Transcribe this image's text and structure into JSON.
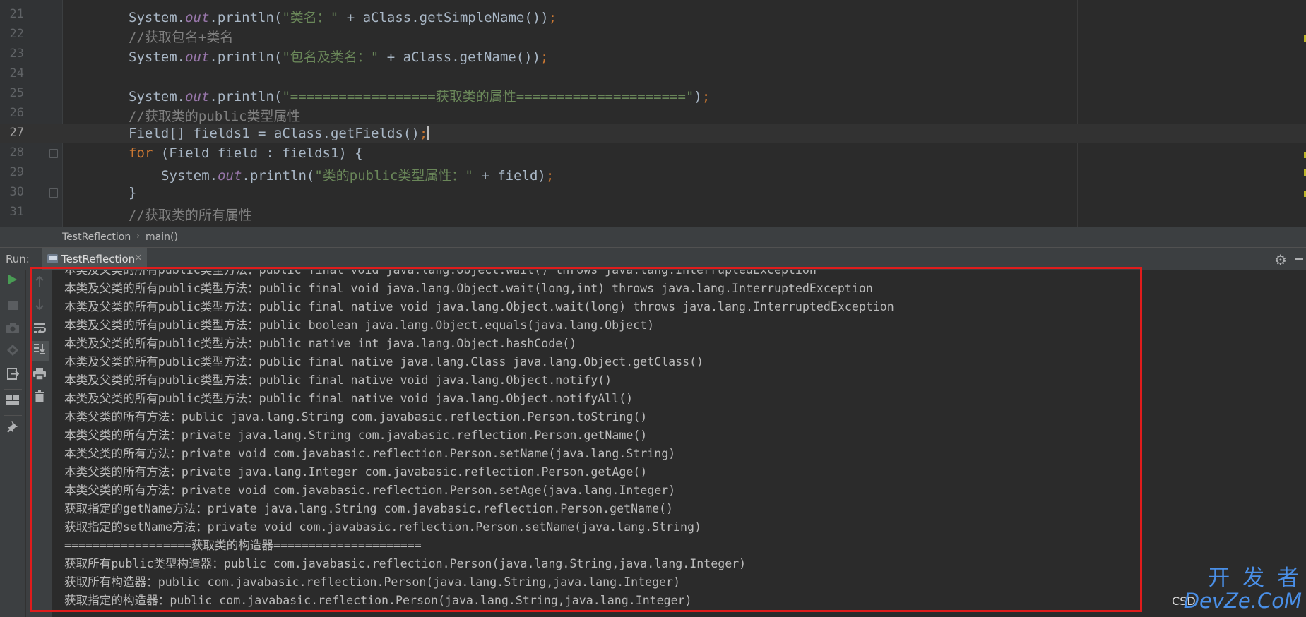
{
  "editor": {
    "lines": [
      {
        "no": "21",
        "segments": [
          {
            "t": "System.",
            "c": "plain"
          },
          {
            "t": "out",
            "c": "out"
          },
          {
            "t": ".println(",
            "c": "plain"
          },
          {
            "t": "\"类名：\"",
            "c": "str"
          },
          {
            "t": " + aClass.getSimpleName())",
            "c": "plain"
          },
          {
            "t": ";",
            "c": "kw"
          }
        ]
      },
      {
        "no": "22",
        "segments": [
          {
            "t": "//获取包名+类名",
            "c": "cmt"
          }
        ]
      },
      {
        "no": "23",
        "segments": [
          {
            "t": "System.",
            "c": "plain"
          },
          {
            "t": "out",
            "c": "out"
          },
          {
            "t": ".println(",
            "c": "plain"
          },
          {
            "t": "\"包名及类名：\"",
            "c": "str"
          },
          {
            "t": " + aClass.getName())",
            "c": "plain"
          },
          {
            "t": ";",
            "c": "kw"
          }
        ]
      },
      {
        "no": "24",
        "segments": []
      },
      {
        "no": "25",
        "segments": [
          {
            "t": "System.",
            "c": "plain"
          },
          {
            "t": "out",
            "c": "out"
          },
          {
            "t": ".println(",
            "c": "plain"
          },
          {
            "t": "\"==================获取类的属性=====================\"",
            "c": "str"
          },
          {
            "t": ")",
            "c": "plain"
          },
          {
            "t": ";",
            "c": "kw"
          }
        ]
      },
      {
        "no": "26",
        "segments": [
          {
            "t": "//获取类的public类型属性",
            "c": "cmt"
          }
        ]
      },
      {
        "no": "27",
        "current": true,
        "segments": [
          {
            "t": "Field[] fields1 = aClass.getFields()",
            "c": "plain"
          },
          {
            "t": ";",
            "c": "kw"
          }
        ]
      },
      {
        "no": "28",
        "fold": true,
        "segments": [
          {
            "t": "for",
            "c": "kw"
          },
          {
            "t": " (Field field : fields1) {",
            "c": "plain"
          }
        ]
      },
      {
        "no": "29",
        "indent": 2,
        "segments": [
          {
            "t": "System.",
            "c": "plain"
          },
          {
            "t": "out",
            "c": "out"
          },
          {
            "t": ".println(",
            "c": "plain"
          },
          {
            "t": "\"类的public类型属性：\"",
            "c": "str"
          },
          {
            "t": " + field)",
            "c": "plain"
          },
          {
            "t": ";",
            "c": "kw"
          }
        ]
      },
      {
        "no": "30",
        "fold": true,
        "segments": [
          {
            "t": "}",
            "c": "plain"
          }
        ]
      },
      {
        "no": "31",
        "segments": [
          {
            "t": "//获取类的所有属性",
            "c": "cmt"
          }
        ]
      }
    ]
  },
  "breadcrumb": {
    "items": [
      "TestReflection",
      "main()"
    ],
    "separator": "›"
  },
  "run_panel": {
    "label": "Run:",
    "tab_label": "TestReflection",
    "tab_close": "×",
    "settings_icon": "gear-icon",
    "hide_icon": "minimize-icon"
  },
  "console": {
    "lines": [
      "本类及父类的所有public类型方法：public final void java.lang.Object.wait() throws java.lang.InterruptedException",
      "本类及父类的所有public类型方法：public final void java.lang.Object.wait(long,int) throws java.lang.InterruptedException",
      "本类及父类的所有public类型方法：public final native void java.lang.Object.wait(long) throws java.lang.InterruptedException",
      "本类及父类的所有public类型方法：public boolean java.lang.Object.equals(java.lang.Object)",
      "本类及父类的所有public类型方法：public native int java.lang.Object.hashCode()",
      "本类及父类的所有public类型方法：public final native java.lang.Class java.lang.Object.getClass()",
      "本类及父类的所有public类型方法：public final native void java.lang.Object.notify()",
      "本类及父类的所有public类型方法：public final native void java.lang.Object.notifyAll()",
      "本类父类的所有方法：public java.lang.String com.javabasic.reflection.Person.toString()",
      "本类父类的所有方法：private java.lang.String com.javabasic.reflection.Person.getName()",
      "本类父类的所有方法：private void com.javabasic.reflection.Person.setName(java.lang.String)",
      "本类父类的所有方法：private java.lang.Integer com.javabasic.reflection.Person.getAge()",
      "本类父类的所有方法：private void com.javabasic.reflection.Person.setAge(java.lang.Integer)",
      "获取指定的getName方法：private java.lang.String com.javabasic.reflection.Person.getName()",
      "获取指定的setName方法：private void com.javabasic.reflection.Person.setName(java.lang.String)",
      "==================获取类的构造器=====================",
      "获取所有public类型构造器：public com.javabasic.reflection.Person(java.lang.String,java.lang.Integer)",
      "获取所有构造器：public com.javabasic.reflection.Person(java.lang.String,java.lang.Integer)",
      "获取指定的构造器：public com.javabasic.reflection.Person(java.lang.String,java.lang.Integer)"
    ]
  },
  "toolbar": {
    "left_icons": [
      "rerun-icon",
      "stop-icon",
      "camera-icon",
      "restore-layout-icon",
      "exit-icon",
      "layout-icon",
      "pin-icon"
    ],
    "right_icons": [
      "scroll-up-icon",
      "scroll-down-icon",
      "soft-wrap-icon",
      "scroll-to-end-icon",
      "print-icon",
      "trash-icon"
    ]
  },
  "colors": {
    "highlight_box": "#e01c1c",
    "watermark": "#4a8fe7"
  },
  "watermark": {
    "prefix": "CSD",
    "top": "开 发 者",
    "bottom": "DevZe.CoM"
  }
}
